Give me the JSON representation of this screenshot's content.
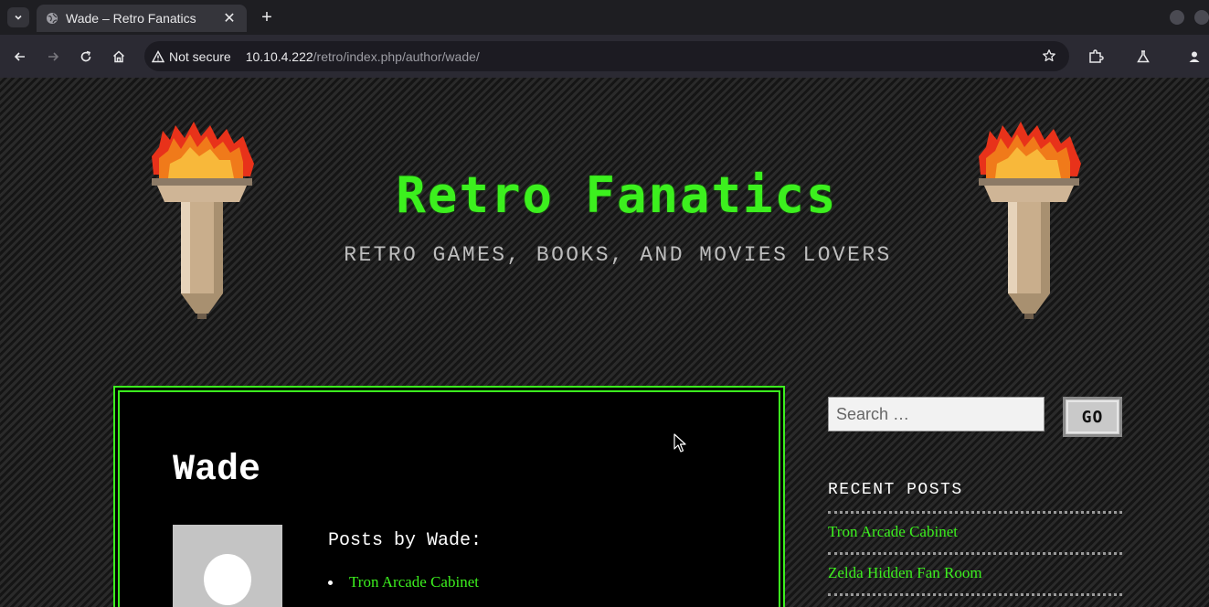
{
  "browser": {
    "tab_title": "Wade – Retro Fanatics",
    "tab_close": "✕",
    "new_tab": "+",
    "security_label": "Not secure",
    "url_host": "10.10.4.222",
    "url_path": "/retro/index.php/author/wade/"
  },
  "site": {
    "title": "Retro Fanatics",
    "description": "RETRO GAMES, BOOKS, AND MOVIES LOVERS"
  },
  "author": {
    "name": "Wade",
    "posts_heading": "Posts by Wade:",
    "posts": [
      "Tron Arcade Cabinet"
    ]
  },
  "sidebar": {
    "search_placeholder": "Search …",
    "search_button": "GO",
    "recent_title": "RECENT POSTS",
    "recent_posts": [
      "Tron Arcade Cabinet",
      "Zelda Hidden Fan Room"
    ]
  },
  "colors": {
    "accent": "#3cf01e",
    "page_bg": "#181818",
    "chrome_bg": "#2b2a33"
  }
}
